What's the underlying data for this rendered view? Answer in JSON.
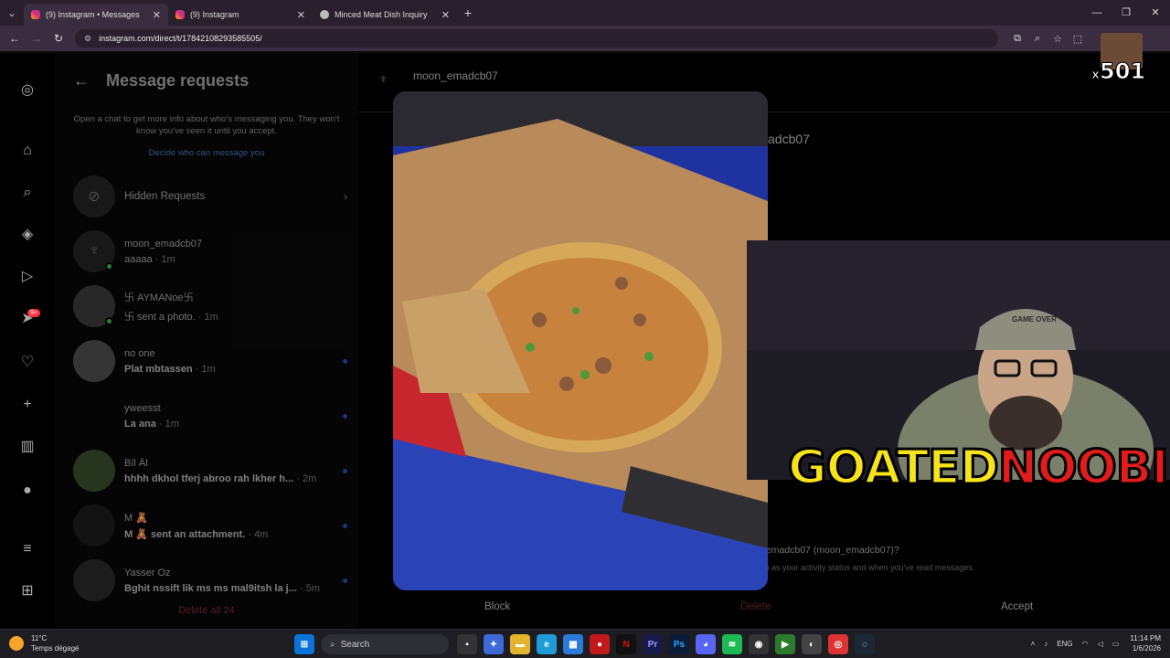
{
  "browser": {
    "tabs": [
      {
        "title": "(9) Instagram • Messages",
        "active": true,
        "icon": "instagram-icon"
      },
      {
        "title": "(9) Instagram",
        "active": false,
        "icon": "instagram-icon"
      },
      {
        "title": "Minced Meat Dish Inquiry",
        "active": false,
        "icon": "globe-icon"
      }
    ],
    "url": "instagram.com/direct/t/17842108293585505/"
  },
  "rail": {
    "notification_badge": "9+"
  },
  "requests": {
    "title": "Message requests",
    "info": "Open a chat to get more info about who's messaging you. They won't know you've seen it until you accept.",
    "decide_link": "Decide who can message you",
    "hidden_label": "Hidden Requests",
    "items": [
      {
        "name": "moon_emadcb07",
        "preview": "ааааа",
        "time": "· 1m",
        "online": true,
        "unread": false
      },
      {
        "name": "卐 AYMANoe卐",
        "preview": "卐 sent a photo.",
        "time": "· 1m",
        "online": true,
        "unread": false
      },
      {
        "name": "no one",
        "preview": "Plat mbtassen",
        "time": "· 1m",
        "online": false,
        "unread": true
      },
      {
        "name": "yweesst",
        "preview": "La ana",
        "time": "· 1m",
        "online": false,
        "unread": true
      },
      {
        "name": "Bíl Âl",
        "preview": "hhhh dkhol tferj abroo rah lkher h...",
        "time": "· 2m",
        "online": false,
        "unread": true
      },
      {
        "name": "M 🧸",
        "preview": "M 🧸 sent an attachment.",
        "time": "· 4m",
        "online": false,
        "unread": true
      },
      {
        "name": "Yasser Oz",
        "preview": "Bghit nssift lik ms ms mal9itsh la j...",
        "time": "· 5m",
        "online": false,
        "unread": true
      }
    ],
    "delete_all": "Delete all 24"
  },
  "chat": {
    "username": "moon_emadcb07",
    "profile_name_partial": "adcb07",
    "question": "_emadcb07 (moon_emadcb07)?",
    "question_sub": "ch as your activity status and when you've read messages.",
    "block": "Block",
    "delete": "Delete",
    "accept": "Accept"
  },
  "stream": {
    "overlay_left": "GOATED",
    "overlay_right": "NOOBIE",
    "multiplier_prefix": "x",
    "multiplier": "501",
    "cap_text": "GAME OVER"
  },
  "taskbar": {
    "temperature": "11°C",
    "weather": "Temps dégagé",
    "search": "Search",
    "lang": "ENG",
    "time": "11:14 PM",
    "date": "1/6/2026"
  },
  "colors": {
    "accent_yellow": "#f6e31a",
    "accent_red": "#e21b1b",
    "unread_dot": "#1c3b8a"
  }
}
